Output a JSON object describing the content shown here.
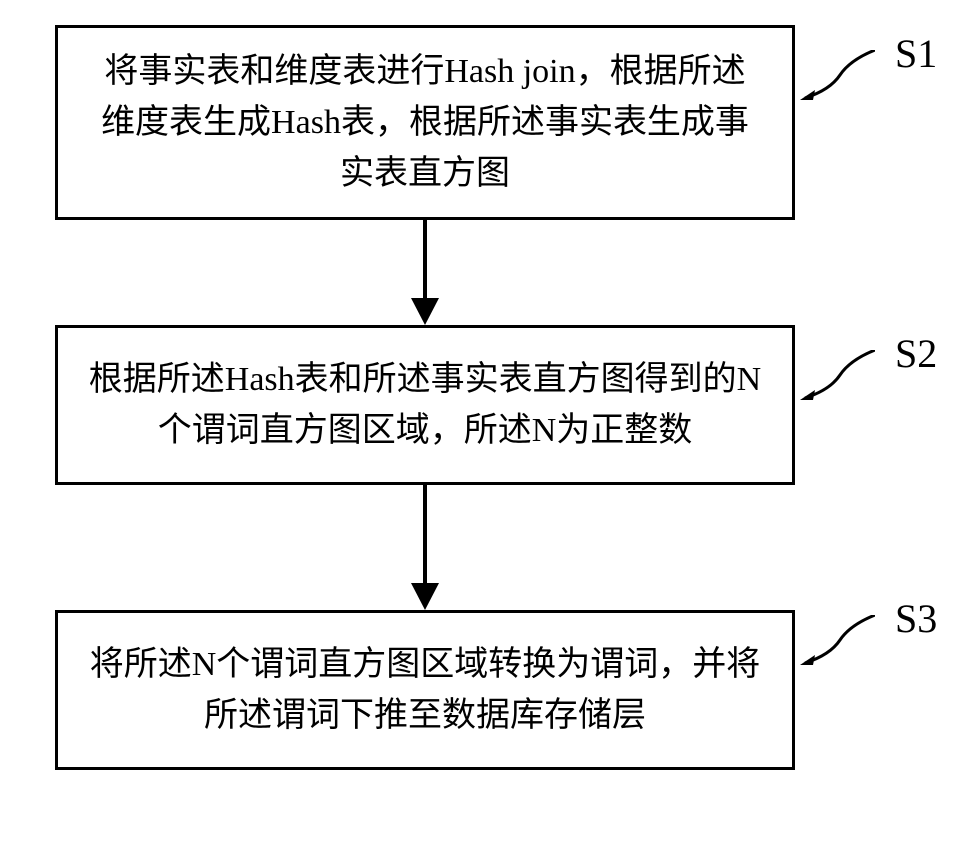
{
  "steps": {
    "s1": {
      "label": "S1",
      "text": "将事实表和维度表进行Hash join，根据所述维度表生成Hash表，根据所述事实表生成事实表直方图"
    },
    "s2": {
      "label": "S2",
      "text": "根据所述Hash表和所述事实表直方图得到的N个谓词直方图区域，所述N为正整数"
    },
    "s3": {
      "label": "S3",
      "text": "将所述N个谓词直方图区域转换为谓词，并将所述谓词下推至数据库存储层"
    }
  }
}
